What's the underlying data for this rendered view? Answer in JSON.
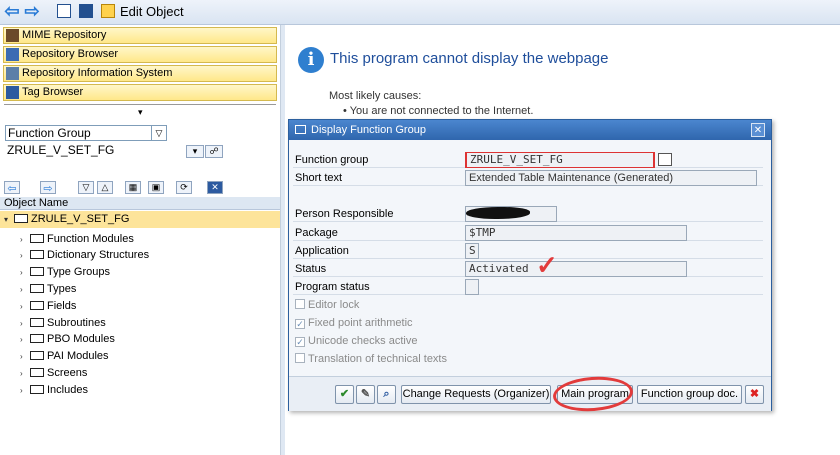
{
  "toolbar": {
    "edit_object": "Edit Object"
  },
  "left_nav": {
    "buttons": [
      "MIME Repository",
      "Repository Browser",
      "Repository Information System",
      "Tag Browser"
    ],
    "object_type": "Function Group",
    "object_name": "ZRULE_V_SET_FG",
    "tree_header": "Object Name",
    "tree_root": "ZRULE_V_SET_FG",
    "tree_items": [
      "Function Modules",
      "Dictionary Structures",
      "Type Groups",
      "Types",
      "Fields",
      "Subroutines",
      "PBO Modules",
      "PAI Modules",
      "Screens",
      "Includes"
    ]
  },
  "browser_error": {
    "title": "This program cannot display the webpage",
    "causes": "Most likely causes:",
    "bullet": "You are not connected to the Internet."
  },
  "dialog": {
    "title": "Display Function Group",
    "fields": {
      "function_group_label": "Function group",
      "function_group_value": "ZRULE_V_SET_FG",
      "short_text_label": "Short text",
      "short_text_value": "Extended Table Maintenance (Generated)",
      "person_label": "Person Responsible",
      "package_label": "Package",
      "package_value": "$TMP",
      "application_label": "Application",
      "application_value": "S",
      "status_label": "Status",
      "status_value": "Activated",
      "program_status_label": "Program status"
    },
    "checkboxes": [
      {
        "label": "Editor lock",
        "checked": false
      },
      {
        "label": "Fixed point arithmetic",
        "checked": true
      },
      {
        "label": "Unicode checks active",
        "checked": true
      },
      {
        "label": "Translation of technical texts",
        "checked": false
      }
    ],
    "footer": {
      "change_requests": "Change Requests (Organizer)",
      "main_program": "Main program",
      "function_group_doc": "Function group doc."
    }
  },
  "colors": {
    "accent": "#2f66ad",
    "highlight": "#fde49a",
    "annotation": "#e23b3b"
  }
}
